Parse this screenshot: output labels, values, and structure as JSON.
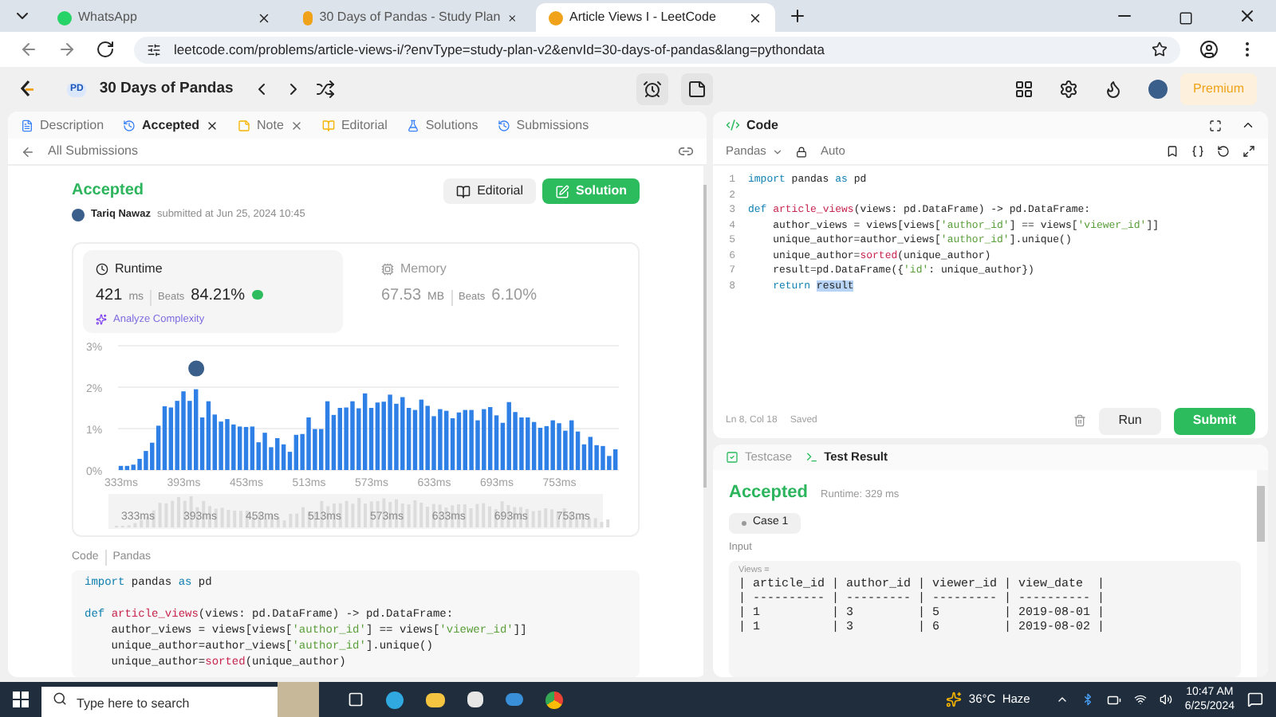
{
  "browser": {
    "tabs": [
      {
        "title": "WhatsApp",
        "selected": false
      },
      {
        "title": "30 Days of Pandas - Study Plan",
        "selected": false
      },
      {
        "title": "Article Views I - LeetCode",
        "selected": true
      }
    ],
    "url": "leetcode.com/problems/article-views-i/?envType=study-plan-v2&envId=30-days-of-pandas&lang=pythondata"
  },
  "header": {
    "badge": "PD",
    "title": "30 Days of Pandas",
    "premium": "Premium"
  },
  "left_tabs": [
    {
      "label": "Description",
      "selected": false,
      "closable": false
    },
    {
      "label": "Accepted",
      "selected": true,
      "closable": true
    },
    {
      "label": "Note",
      "selected": false,
      "closable": true
    },
    {
      "label": "Editorial",
      "selected": false,
      "closable": false
    },
    {
      "label": "Solutions",
      "selected": false,
      "closable": false
    },
    {
      "label": "Submissions",
      "selected": false,
      "closable": false
    }
  ],
  "back_link": "All Submissions",
  "submission": {
    "status": "Accepted",
    "author": "Tariq Nawaz",
    "submitted": "submitted at Jun 25, 2024 10:45",
    "editorial": "Editorial",
    "solution": "Solution",
    "stats": [
      {
        "label": "Runtime",
        "value": "421",
        "unit": "ms",
        "beats_label": "Beats",
        "beats": "84.21%",
        "selected": true
      },
      {
        "label": "Memory",
        "value": "67.53",
        "unit": "MB",
        "beats_label": "Beats",
        "beats": "6.10%",
        "selected": false
      }
    ],
    "analyze": "Analyze Complexity",
    "chart_data": {
      "type": "bar",
      "categories": [
        "333ms",
        null,
        null,
        null,
        null,
        null,
        null,
        null,
        null,
        null,
        "393ms",
        null,
        null,
        null,
        null,
        null,
        null,
        null,
        null,
        null,
        "453ms",
        null,
        null,
        null,
        null,
        null,
        null,
        null,
        null,
        null,
        "513ms",
        null,
        null,
        null,
        null,
        null,
        null,
        null,
        null,
        null,
        "573ms",
        null,
        null,
        null,
        null,
        null,
        null,
        null,
        null,
        null,
        "633ms",
        null,
        null,
        null,
        null,
        null,
        null,
        null,
        null,
        null,
        "693ms",
        null,
        null,
        null,
        null,
        null,
        null,
        null,
        null,
        null,
        "753ms",
        null,
        null,
        null,
        null,
        null,
        null,
        null,
        null,
        null
      ],
      "values": [
        0.1,
        0.1,
        0.13,
        0.27,
        0.46,
        0.66,
        1.07,
        1.54,
        1.51,
        1.67,
        1.9,
        1.67,
        1.95,
        1.27,
        1.66,
        1.34,
        1.17,
        1.23,
        1.1,
        1.05,
        1.04,
        1.05,
        0.67,
        0.9,
        0.55,
        0.77,
        0.62,
        0.44,
        0.85,
        0.87,
        1.27,
        0.99,
        0.99,
        1.66,
        1.33,
        1.5,
        1.51,
        1.66,
        1.49,
        1.85,
        1.5,
        1.63,
        1.65,
        1.82,
        1.6,
        1.76,
        1.5,
        1.45,
        1.7,
        1.55,
        1.3,
        1.47,
        1.43,
        1.25,
        1.39,
        1.45,
        1.45,
        1.2,
        1.47,
        1.52,
        1.32,
        1.14,
        1.64,
        1.4,
        1.27,
        1.27,
        1.16,
        1.02,
        1.06,
        1.2,
        1.13,
        0.95,
        1.2,
        0.93,
        0.62,
        0.8,
        0.6,
        0.58,
        0.34,
        0.5
      ],
      "ylim": [
        0,
        3
      ],
      "yticks": [
        {
          "value": 0,
          "label": "0%"
        },
        {
          "value": 1,
          "label": "1%"
        },
        {
          "value": 2,
          "label": "2%"
        },
        {
          "value": 3,
          "label": "3%"
        }
      ]
    },
    "navigator_labels": [
      "333ms",
      "393ms",
      "453ms",
      "513ms",
      "573ms",
      "633ms",
      "693ms",
      "753ms"
    ],
    "code_label": "Code",
    "language": "Pandas",
    "code": [
      {
        "kind": "code",
        "tokens": [
          {
            "text": "import",
            "kind": "kw"
          },
          {
            "text": " pandas ",
            "kind": "plain"
          },
          {
            "text": "as",
            "kind": "kw"
          },
          {
            "text": " pd",
            "kind": "plain"
          }
        ]
      },
      {
        "kind": "blank"
      },
      {
        "kind": "code",
        "tokens": [
          {
            "text": "def ",
            "kind": "kw"
          },
          {
            "text": "article_views",
            "kind": "fn"
          },
          {
            "text": "(views: pd.DataFrame) -> pd.DataFrame:",
            "kind": "plain"
          }
        ]
      },
      {
        "kind": "code",
        "tokens": [
          {
            "text": "    author_views = views[views[",
            "kind": "plain"
          },
          {
            "text": "'author_id'",
            "kind": "str"
          },
          {
            "text": "] == views[",
            "kind": "plain"
          },
          {
            "text": "'viewer_id'",
            "kind": "str"
          },
          {
            "text": "]]",
            "kind": "plain"
          }
        ]
      },
      {
        "kind": "code",
        "tokens": [
          {
            "text": "    unique_author=author_views[",
            "kind": "plain"
          },
          {
            "text": "'author_id'",
            "kind": "str"
          },
          {
            "text": "].unique()",
            "kind": "plain"
          }
        ]
      },
      {
        "kind": "code",
        "tokens": [
          {
            "text": "    unique_author=",
            "kind": "plain"
          },
          {
            "text": "sorted",
            "kind": "fn"
          },
          {
            "text": "(unique_author)",
            "kind": "plain"
          }
        ]
      }
    ]
  },
  "editor": {
    "title": "Code",
    "language": "Pandas",
    "mode": "Auto",
    "lines": [
      {
        "number": "1",
        "tokens": [
          {
            "text": "import",
            "kind": "kw"
          },
          {
            "text": " pandas ",
            "kind": "plain"
          },
          {
            "text": "as",
            "kind": "kw"
          },
          {
            "text": " pd",
            "kind": "plain"
          }
        ]
      },
      {
        "number": "2"
      },
      {
        "number": "3",
        "tokens": [
          {
            "text": "def ",
            "kind": "kw"
          },
          {
            "text": "article_views",
            "kind": "fn"
          },
          {
            "text": "(views: pd.DataFrame) -> pd.DataFrame:",
            "kind": "plain"
          }
        ]
      },
      {
        "number": "4",
        "tokens": [
          {
            "text": "    author_views = views[views[",
            "kind": "plain"
          },
          {
            "text": "'author_id'",
            "kind": "str"
          },
          {
            "text": "] == views[",
            "kind": "plain"
          },
          {
            "text": "'viewer_id'",
            "kind": "str"
          },
          {
            "text": "]]",
            "kind": "plain"
          }
        ]
      },
      {
        "number": "5",
        "tokens": [
          {
            "text": "    unique_author=author_views[",
            "kind": "plain"
          },
          {
            "text": "'author_id'",
            "kind": "str"
          },
          {
            "text": "].unique()",
            "kind": "plain"
          }
        ]
      },
      {
        "number": "6",
        "tokens": [
          {
            "text": "    unique_author=",
            "kind": "plain"
          },
          {
            "text": "sorted",
            "kind": "fn"
          },
          {
            "text": "(unique_author)",
            "kind": "plain"
          }
        ]
      },
      {
        "number": "7",
        "tokens": [
          {
            "text": "    result=pd.DataFrame({",
            "kind": "plain"
          },
          {
            "text": "'id'",
            "kind": "str"
          },
          {
            "text": ": unique_author})",
            "kind": "plain"
          }
        ]
      },
      {
        "number": "8",
        "tokens": [
          {
            "text": "    return ",
            "kind": "kw"
          },
          {
            "text": "result",
            "kind": "selected"
          }
        ]
      }
    ],
    "position": "Ln 8, Col 18",
    "saved": "Saved",
    "run": "Run",
    "submit": "Submit"
  },
  "test_panel": {
    "tabs": [
      {
        "label": "Testcase",
        "selected": false
      },
      {
        "label": "Test Result",
        "selected": true
      }
    ],
    "status": "Accepted",
    "runtime": "Runtime: 329 ms",
    "case": "Case 1",
    "input_label": "Input",
    "var_label": "Views =",
    "table_lines": [
      "| article_id | author_id | viewer_id | view_date  |",
      "| ---------- | --------- | --------- | ---------- |",
      "| 1          | 3         | 5         | 2019-08-01 |",
      "| 1          | 3         | 6         | 2019-08-02 |"
    ]
  },
  "taskbar": {
    "search_placeholder": "Type here to search",
    "weather": "36°C  Haze",
    "time": "10:47 AM",
    "date": "6/25/2024"
  }
}
